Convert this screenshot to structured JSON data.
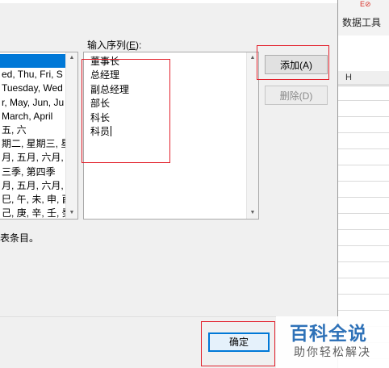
{
  "excel": {
    "ribbon_tab": "数据工具",
    "ribbon_icon": "E⊘",
    "column_label": "H"
  },
  "dialog": {
    "input_label_prefix": "输入序列(",
    "input_label_key": "E",
    "input_label_suffix": "):",
    "left_list": [
      "",
      "ed, Thu, Fri, S",
      "Tuesday, Wed",
      "r, May, Jun, Ju",
      "March, April",
      "五, 六",
      "期二, 星期三, 星",
      "月, 五月, 六月,",
      "三季, 第四季",
      "月, 五月, 六月,",
      "巳, 午, 未, 申, 酉",
      "己, 庚, 辛, 壬, 癸"
    ],
    "selected_index": 0,
    "sequence_lines": [
      "董事长",
      "总经理",
      "副总经理",
      "部长",
      "科长",
      "科员"
    ],
    "add_button": "添加(A)",
    "delete_button": "删除(D)",
    "hint_text": "表条目。",
    "ok_button": "确定"
  },
  "watermark": {
    "title": "百科全说",
    "subtitle": "助你轻松解决"
  }
}
